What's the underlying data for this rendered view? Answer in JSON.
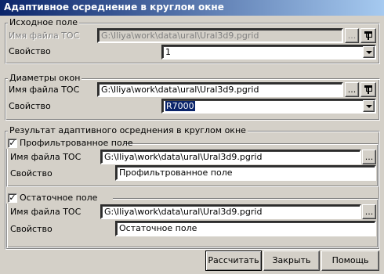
{
  "window": {
    "title": "Адаптивное осреднение в круглом окне"
  },
  "source": {
    "title": "Исходное поле",
    "file_label": "Имя файла ТОС",
    "file_value": "G:\\Iliya\\work\\data\\ural\\Ural3d9.pgrid",
    "browse_label": "...",
    "property_label": "Свойство",
    "property_value": "1"
  },
  "diameters": {
    "title": "Диаметры окон",
    "file_label": "Имя файла ТОС",
    "file_value": "G:\\Iliya\\work\\data\\ural\\Ural3d9.pgrid",
    "browse_label": "...",
    "property_label": "Свойство",
    "property_value": "R7000"
  },
  "result": {
    "title": "Результат адаптивного осреднения в круглом окне",
    "filtered": {
      "title": "Профильтрованное поле",
      "checked": true,
      "file_label": "Имя файла ТОС",
      "file_value": "G:\\Iliya\\work\\data\\ural\\Ural3d9.pgrid",
      "browse_label": "...",
      "property_label": "Свойство",
      "property_value": "Профильтрованное поле"
    },
    "residual": {
      "title": "Остаточное поле",
      "checked": true,
      "file_label": "Имя файла ТОС",
      "file_value": "G:\\Iliya\\work\\data\\ural\\Ural3d9.pgrid",
      "browse_label": "...",
      "property_label": "Свойство",
      "property_value": "Остаточное поле"
    }
  },
  "buttons": {
    "calculate": "Рассчитать",
    "close": "Закрыть",
    "help": "Помощь"
  },
  "check_mark": "✓"
}
